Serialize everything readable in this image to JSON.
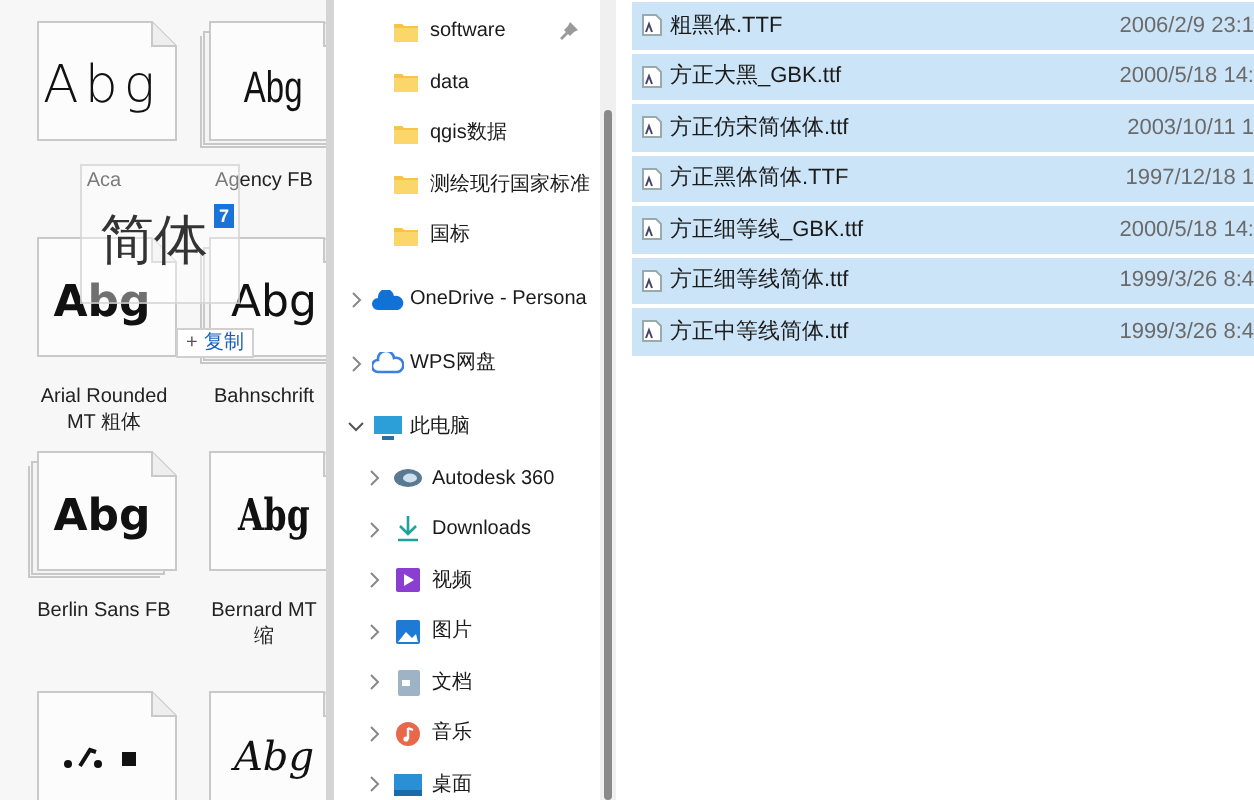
{
  "font_tiles": [
    {
      "kind": "sample",
      "preview": "Abg",
      "stacked": false,
      "label": [
        "Aca"
      ]
    },
    {
      "kind": "sample",
      "preview": "Abg",
      "stacked": true,
      "label": [
        "Agency FB"
      ]
    },
    {
      "kind": "sample",
      "preview": "Abg",
      "stacked": false,
      "label": [
        "Arial Rounded",
        "MT 粗体"
      ]
    },
    {
      "kind": "sample",
      "preview": "Abg",
      "stacked": true,
      "label": [
        "Bahnschrift"
      ]
    },
    {
      "kind": "sample",
      "preview": "Abg",
      "stacked": true,
      "label": [
        "Berlin Sans FB"
      ]
    },
    {
      "kind": "sample",
      "preview": "Abg",
      "stacked": false,
      "label": [
        "Bernard MT",
        "缩"
      ]
    },
    {
      "kind": "symbols",
      "stacked": false
    },
    {
      "kind": "sample",
      "preview": "Abg",
      "stacked": false
    }
  ],
  "drag_ghost": {
    "text": "简体",
    "count": "7",
    "action_symbol": "+",
    "action": "复制"
  },
  "nav_tree": [
    {
      "kind": "folder",
      "label": "software",
      "pinned": true
    },
    {
      "kind": "folder",
      "label": "data",
      "pinned": false
    },
    {
      "kind": "folder",
      "label": "qgis数据",
      "pinned": false
    },
    {
      "kind": "folder",
      "label": "测绘现行国家标准",
      "pinned": false
    },
    {
      "kind": "folder",
      "label": "国标",
      "pinned": false
    },
    {
      "kind": "root",
      "label": "OneDrive - Persona",
      "expanded": false
    },
    {
      "kind": "root",
      "label": "WPS网盘",
      "expanded": false
    },
    {
      "kind": "root",
      "label": "此电脑",
      "expanded": true,
      "children": [
        {
          "label": "Autodesk 360"
        },
        {
          "label": "Downloads"
        },
        {
          "label": "视频"
        },
        {
          "label": "图片"
        },
        {
          "label": "文档"
        },
        {
          "label": "音乐"
        },
        {
          "label": "桌面"
        }
      ]
    }
  ],
  "files": [
    {
      "name": "粗黑体.TTF",
      "date": "2006/2/9 23:1",
      "selected": true
    },
    {
      "name": "方正大黑_GBK.ttf",
      "date": "2000/5/18 14:",
      "selected": true
    },
    {
      "name": "方正仿宋简体体.ttf",
      "date": "2003/10/11 1",
      "selected": true
    },
    {
      "name": "方正黑体简体.TTF",
      "date": "1997/12/18 1",
      "selected": true
    },
    {
      "name": "方正细等线_GBK.ttf",
      "date": "2000/5/18 14:",
      "selected": true
    },
    {
      "name": "方正细等线简体.ttf",
      "date": "1999/3/26 8:4",
      "selected": true
    },
    {
      "name": "方正中等线简体.ttf",
      "date": "1999/3/26 8:4",
      "selected": true
    }
  ]
}
